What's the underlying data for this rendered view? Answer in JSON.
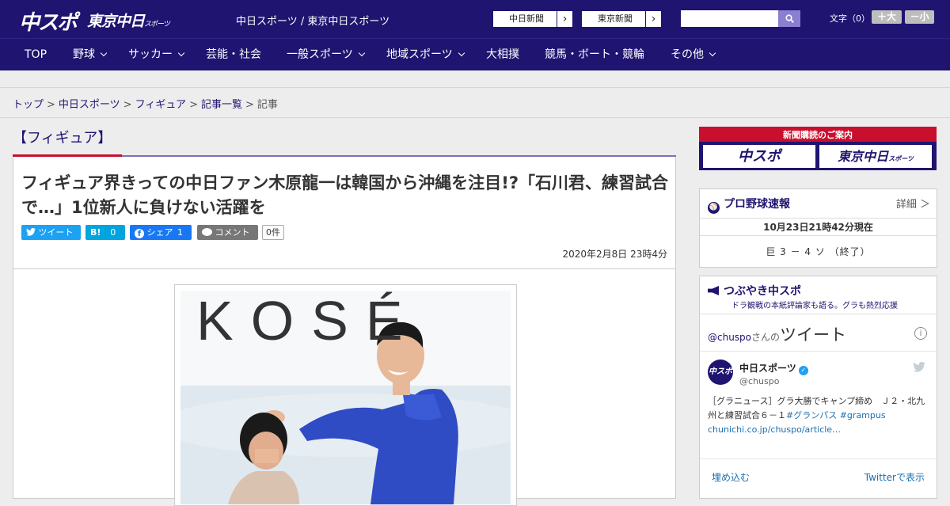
{
  "header": {
    "logo_chuspo": "中スポ",
    "logo_tokyo": "東京中日",
    "logo_tokyo_small": "スポーツ",
    "site_title": "中日スポーツ / 東京中日スポーツ",
    "paper_links": [
      "中日新聞",
      "東京新聞"
    ],
    "search_placeholder": "",
    "font_label": "文字（0）",
    "font_bigger": "＋大",
    "font_smaller": "－小"
  },
  "nav": [
    "TOP",
    "野球",
    "サッカー",
    "芸能・社会",
    "一般スポーツ",
    "地域スポーツ",
    "大相撲",
    "競馬・ボート・競輪",
    "その他"
  ],
  "breadcrumb": [
    "トップ",
    "中日スポーツ",
    "フィギュア",
    "記事一覧",
    "記事"
  ],
  "article": {
    "category": "【フィギュア】",
    "headline": "フィギュア界きっての中日ファン木原龍一は韓国から沖縄を注目!?「石川君、練習試合で…」1位新人に負けない活躍を",
    "share": {
      "tweet": "ツイート",
      "hatena_label": "B!",
      "hatena_count": "0",
      "facebook": "シェア",
      "facebook_count": "1",
      "comment": "コメント",
      "comment_count": "0件"
    },
    "date": "2020年2月8日 23時4分",
    "photo_sign": "KOSÉ"
  },
  "sidebar": {
    "subscribe_title": "新聞購読のご案内",
    "subscribe_buttons": [
      "中スポ",
      "東京中日"
    ],
    "subscribe_small": "スポーツ",
    "baseball_title": "プロ野球速報",
    "baseball_detail": "詳細 ＞",
    "baseball_time": "10月23日21時42分現在",
    "baseball_score": "巨 3 － 4 ソ （終了）",
    "twitter_title": "つぶやき中スポ",
    "twitter_sub": "ドラ観戦の本紙評論家も語る。グラも熱烈応援",
    "tweet_user_prefix": "@chuspo",
    "tweet_user_mid": "さんの",
    "tweet_user_big": "ツイート",
    "tweet_name": "中日スポーツ",
    "tweet_handle": "@chuspo",
    "tweet_text_main": "［グラニュース］グラ大勝でキャンプ締め　Ｊ２・北九州と練習試合６－１",
    "tweet_tag1": "#グランパス",
    "tweet_tag2": "#grampus",
    "tweet_link": "chunichi.co.jp/chuspo/article…",
    "embed": "埋め込む",
    "view_on_twitter": "Twitterで表示",
    "avatar_text": "中スポ"
  },
  "colors": {
    "brand_navy": "#1f1470",
    "brand_red": "#c8102e",
    "twitter_blue": "#1da1f2",
    "facebook_blue": "#1877f2",
    "hatena_blue": "#00a4de",
    "comment_gray": "#777777"
  }
}
